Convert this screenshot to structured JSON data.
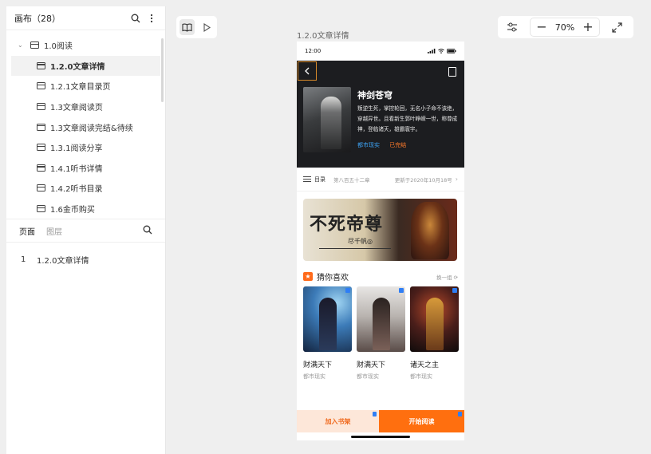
{
  "canvas": {
    "title": "画布（28）"
  },
  "tree": {
    "root": "1.0阅读",
    "items": [
      "1.2.0文章详情",
      "1.2.1文章目录页",
      "1.3文章阅读页",
      "1.3文章阅读完结&待续",
      "1.3.1阅读分享",
      "1.4.1听书详情",
      "1.4.2听书目录",
      "1.6金币购买"
    ],
    "selected_index": 0
  },
  "panel_tabs": {
    "pages": "页面",
    "layers": "图层"
  },
  "pages": [
    {
      "num": "1",
      "name": "1.2.0文章详情"
    }
  ],
  "toolbar": {
    "zoom": "70%",
    "zoom_out": "−",
    "zoom_in": "+"
  },
  "artboard": {
    "label": "1.2.0文章详情",
    "status_time": "12:00",
    "book": {
      "title": "神剑苍穹",
      "description": "叛逆生死，掌控轮回，无名小子命不该绝，穿越异世。且看新生郭叶峥嵘一世，称尊成神，登临诸天，雄霸寰宇。",
      "tag_genre": "都市现实",
      "tag_status": "已完结"
    },
    "toc": {
      "label": "目录",
      "chapter": "第八百五十二章",
      "updated": "更新于2020年10月18号"
    },
    "banner": {
      "title": "不死帝尊",
      "author": "尽千帆◎"
    },
    "guess": {
      "title": "猜你喜欢",
      "refresh": "换一组"
    },
    "books": [
      {
        "name": "财满天下",
        "genre": "都市现实"
      },
      {
        "name": "财满天下",
        "genre": "都市现实"
      },
      {
        "name": "诸天之主",
        "genre": "都市现实"
      }
    ],
    "actions": {
      "add_shelf": "加入书架",
      "start_read": "开始阅读"
    }
  },
  "colors": {
    "accent": "#ff6f0f",
    "tag_blue": "#3da4f5",
    "tag_orange": "#ff7a2a"
  }
}
